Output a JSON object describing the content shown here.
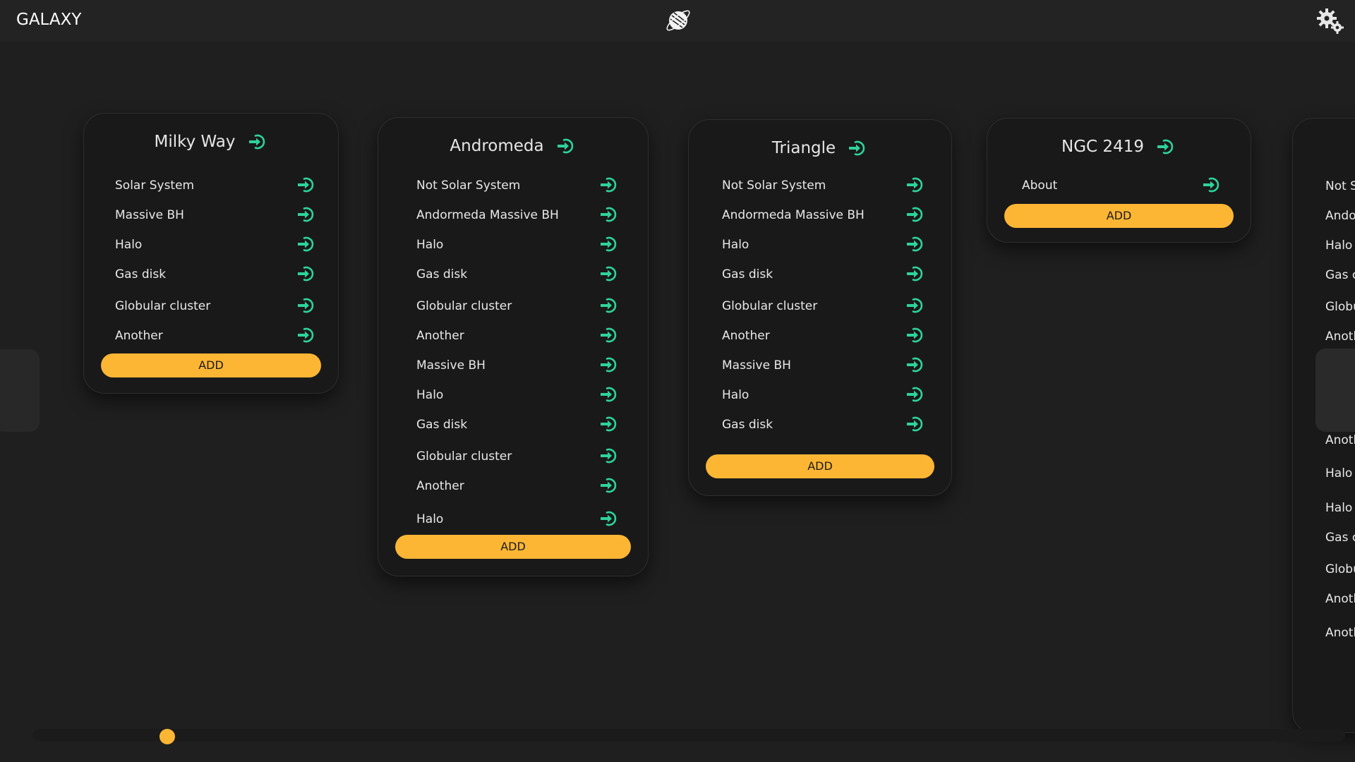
{
  "app": {
    "title": "GALAXY",
    "logo_icon": "planet-logo-icon",
    "settings_icon": "gears-icon"
  },
  "colors": {
    "background": "#1f1f1f",
    "topbar": "#232323",
    "card": "#191919",
    "accent": "#fdb634",
    "icon": "#2ed39a"
  },
  "cards": [
    {
      "title": "Milky Way",
      "items": [
        "Solar System",
        "Massive BH",
        "Halo",
        "Gas disk",
        "Globular cluster",
        "Another"
      ],
      "add_label": "ADD"
    },
    {
      "title": "Andromeda",
      "items": [
        "Not Solar System",
        "Andormeda Massive BH",
        "Halo",
        "Gas disk",
        "Globular cluster",
        "Another",
        "Massive BH",
        "Halo",
        "Gas disk",
        "Globular cluster",
        "Another",
        "Halo"
      ],
      "add_label": "ADD"
    },
    {
      "title": "Triangle",
      "items": [
        "Not Solar System",
        "Andormeda Massive BH",
        "Halo",
        "Gas disk",
        "Globular cluster",
        "Another",
        "Massive BH",
        "Halo",
        "Gas disk"
      ],
      "add_label": "ADD"
    },
    {
      "title": "NGC 2419",
      "items": [
        "About"
      ],
      "add_label": "ADD"
    }
  ],
  "partial_card": {
    "items_top": [
      "Not S",
      "Ando",
      "Halo",
      "Gas c",
      "Globu",
      "Anoth"
    ],
    "items_bottom": [
      "Globu",
      "Anoth",
      "Halo",
      "Halo",
      "Gas c",
      "Globu",
      "Anoth",
      "Anoth"
    ]
  },
  "scroll": {
    "position_fraction": 0.097
  }
}
